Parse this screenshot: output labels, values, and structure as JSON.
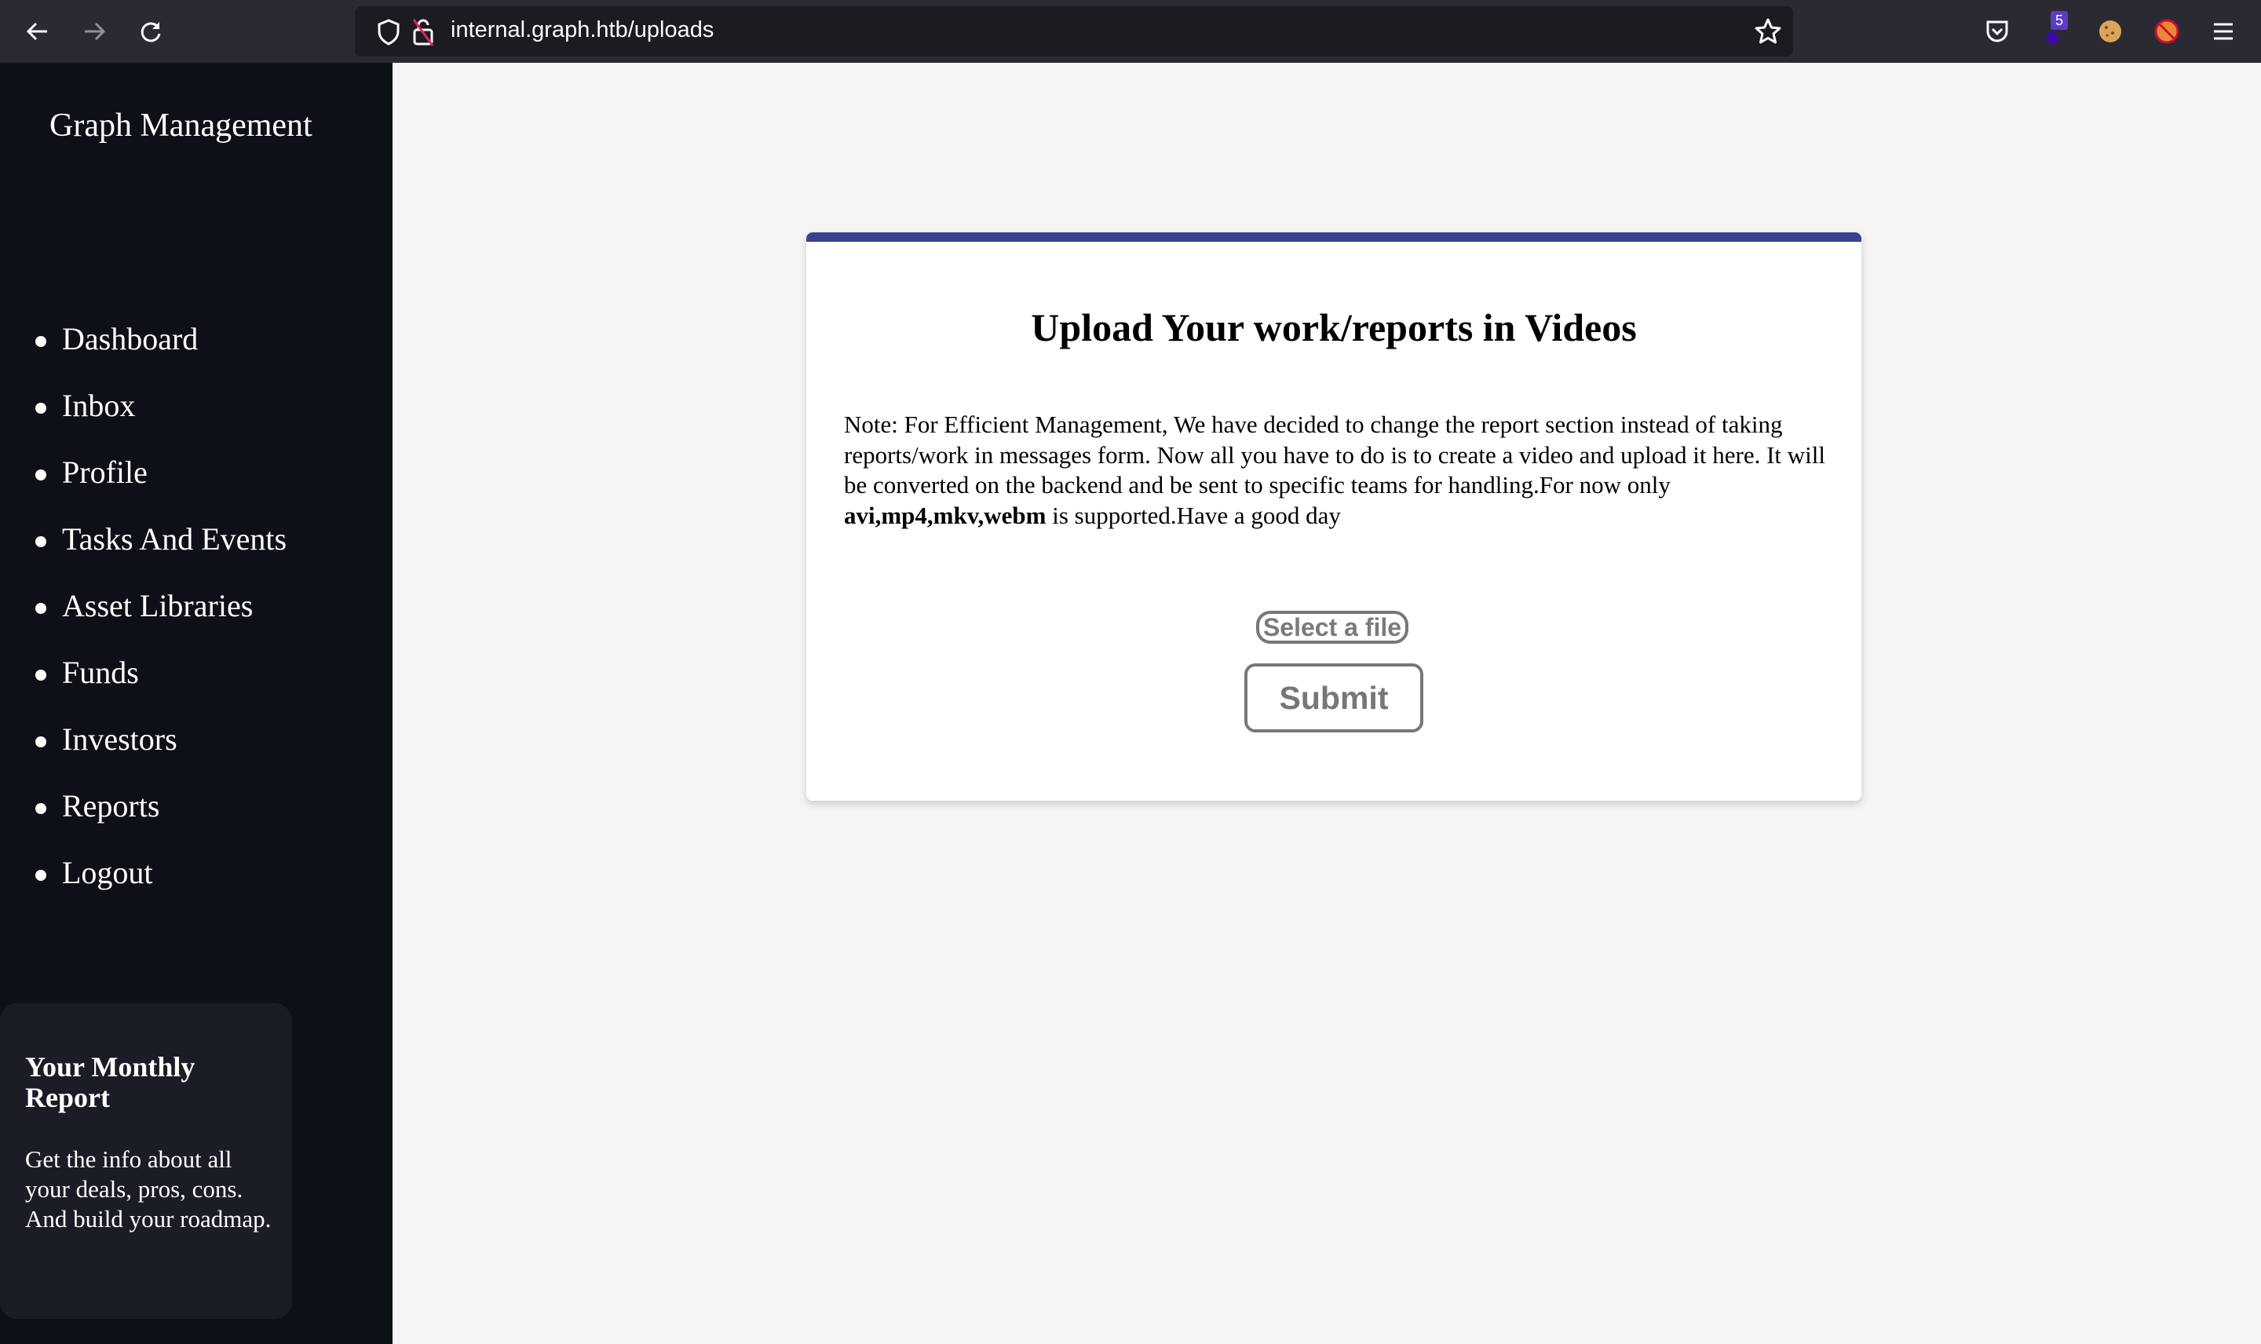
{
  "browser": {
    "url": "internal.graph.htb/uploads",
    "extension_badge": "5",
    "icons": [
      "back-icon",
      "forward-icon",
      "reload-icon",
      "shield-icon",
      "insecure-lock-icon",
      "star-icon",
      "pocket-icon",
      "extension-icon",
      "cookie-icon",
      "blocked-fox-icon",
      "menu-icon"
    ]
  },
  "sidebar": {
    "brand": "Graph Management",
    "items": [
      {
        "label": "Dashboard"
      },
      {
        "label": "Inbox"
      },
      {
        "label": "Profile"
      },
      {
        "label": "Tasks And Events"
      },
      {
        "label": "Asset Libraries"
      },
      {
        "label": "Funds"
      },
      {
        "label": "Investors"
      },
      {
        "label": "Reports"
      },
      {
        "label": "Logout"
      }
    ],
    "report_card": {
      "title": "Your Monthly Report",
      "text": "Get the info about all your deals, pros, cons. And build your roadmap."
    }
  },
  "upload": {
    "title": "Upload Your work/reports in Videos",
    "note_prefix": "Note: For Efficient Management, We have decided to change the report section instead of taking reports/work in messages form. Now all you have to do is to create a video and upload it here. It will be converted on the backend and be sent to specific teams for handling.For now only ",
    "note_formats": "avi,mp4,mkv,webm",
    "note_suffix": " is supported.Have a good day",
    "select_file_label": "Select a file",
    "submit_label": "Submit"
  },
  "colors": {
    "accent_bar": "#374190",
    "sidebar_bg": "#0d1117",
    "page_bg": "#f5f5f5"
  }
}
